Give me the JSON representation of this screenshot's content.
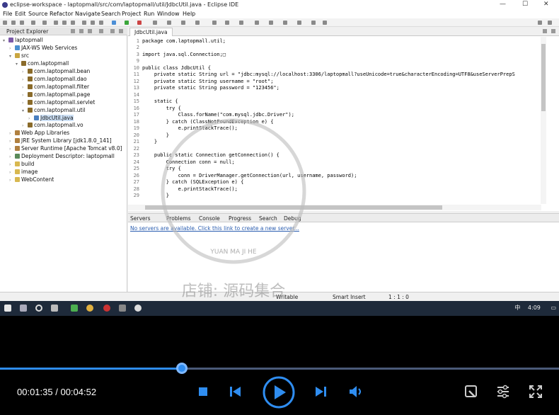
{
  "window": {
    "title": "eclipse-workspace - laptopmall/src/com/laptopmall/util/JdbcUtil.java - Eclipse IDE",
    "controls": [
      "—",
      "☐",
      "✕"
    ]
  },
  "menu": [
    "File",
    "Edit",
    "Source",
    "Refactor",
    "Navigate",
    "Search",
    "Project",
    "Run",
    "Window",
    "Help"
  ],
  "explorer": {
    "title": "Project Explorer",
    "tree": [
      {
        "label": "laptopmall",
        "depth": 0,
        "arrow": "v",
        "icon": "project-icon"
      },
      {
        "label": "JAX-WS Web Services",
        "depth": 1,
        "arrow": ">",
        "icon": "webservice-icon"
      },
      {
        "label": "src",
        "depth": 1,
        "arrow": "v",
        "icon": "source-folder-icon"
      },
      {
        "label": "com.laptopmall",
        "depth": 2,
        "arrow": "v",
        "icon": "package-icon"
      },
      {
        "label": "com.laptopmall.bean",
        "depth": 3,
        "arrow": ">",
        "icon": "package-icon"
      },
      {
        "label": "com.laptopmall.dao",
        "depth": 3,
        "arrow": ">",
        "icon": "package-icon"
      },
      {
        "label": "com.laptopmall.filter",
        "depth": 3,
        "arrow": ">",
        "icon": "package-icon"
      },
      {
        "label": "com.laptopmall.page",
        "depth": 3,
        "arrow": ">",
        "icon": "package-icon"
      },
      {
        "label": "com.laptopmall.servlet",
        "depth": 3,
        "arrow": ">",
        "icon": "package-icon"
      },
      {
        "label": "com.laptopmall.util",
        "depth": 3,
        "arrow": "v",
        "icon": "package-icon"
      },
      {
        "label": "JdbcUtil.java",
        "depth": 4,
        "arrow": ">",
        "icon": "java-file-icon",
        "selected": true
      },
      {
        "label": "com.laptopmall.vo",
        "depth": 3,
        "arrow": ">",
        "icon": "package-icon"
      },
      {
        "label": "Web App Libraries",
        "depth": 1,
        "arrow": ">",
        "icon": "library-icon"
      },
      {
        "label": "JRE System Library [jdk1.8.0_141]",
        "depth": 1,
        "arrow": ">",
        "icon": "library-icon"
      },
      {
        "label": "Server Runtime [Apache Tomcat v8.0]",
        "depth": 1,
        "arrow": ">",
        "icon": "library-icon"
      },
      {
        "label": "Deployment Descriptor: laptopmall",
        "depth": 1,
        "arrow": ">",
        "icon": "descriptor-icon"
      },
      {
        "label": "build",
        "depth": 1,
        "arrow": ">",
        "icon": "folder-icon"
      },
      {
        "label": "image",
        "depth": 1,
        "arrow": ">",
        "icon": "folder-icon"
      },
      {
        "label": "WebContent",
        "depth": 1,
        "arrow": ">",
        "icon": "folder-icon"
      }
    ]
  },
  "editor": {
    "tab": "JdbcUtil.java",
    "lines": [
      {
        "n": "1",
        "text": "package com.laptopmall.util;"
      },
      {
        "n": "2",
        "text": ""
      },
      {
        "n": "3",
        "text": "import java.sql.Connection;□"
      },
      {
        "n": "9",
        "text": ""
      },
      {
        "n": "10",
        "text": "public class JdbcUtil {"
      },
      {
        "n": "11",
        "text": "    private static String url = \"jdbc:mysql://localhost:3306/laptopmall?useUnicode=true&characterEncoding=UTF8&useServerPrepS"
      },
      {
        "n": "12",
        "text": "    private static String username = \"root\";"
      },
      {
        "n": "13",
        "text": "    private static String password = \"123456\";"
      },
      {
        "n": "14",
        "text": ""
      },
      {
        "n": "15",
        "text": "    static {"
      },
      {
        "n": "16",
        "text": "        try {"
      },
      {
        "n": "17",
        "text": "            Class.forName(\"com.mysql.jdbc.Driver\");"
      },
      {
        "n": "18",
        "text": "        } catch (ClassNotFoundException e) {"
      },
      {
        "n": "19",
        "text": "            e.printStackTrace();"
      },
      {
        "n": "20",
        "text": "        }"
      },
      {
        "n": "21",
        "text": "    }"
      },
      {
        "n": "22",
        "text": ""
      },
      {
        "n": "23",
        "text": "    public static Connection getConnection() {"
      },
      {
        "n": "24",
        "text": "        Connection conn = null;"
      },
      {
        "n": "25",
        "text": "        try {"
      },
      {
        "n": "26",
        "text": "            conn = DriverManager.getConnection(url, username, password);"
      },
      {
        "n": "27",
        "text": "        } catch (SQLException e) {"
      },
      {
        "n": "28",
        "text": "            e.printStackTrace();"
      },
      {
        "n": "29",
        "text": "        }"
      }
    ]
  },
  "bottom_panel": {
    "tabs": [
      "Servers",
      "Problems",
      "Console",
      "Progress",
      "Search",
      "Debug"
    ],
    "message": "No servers are available. Click this link to create a new server..."
  },
  "statusbar": {
    "mode": "Writable",
    "insert": "Smart Insert",
    "position": "1 : 1 : 0"
  },
  "taskbar": {
    "clock": "4:09",
    "ime": "中"
  },
  "watermark": {
    "pinyin": "YUAN MA JI HE",
    "shop": "店铺: 源码集合"
  },
  "player": {
    "current_time": "00:01:35",
    "total_time": "00:04:52",
    "progress": 0.325,
    "accent": "#2f8df0"
  }
}
